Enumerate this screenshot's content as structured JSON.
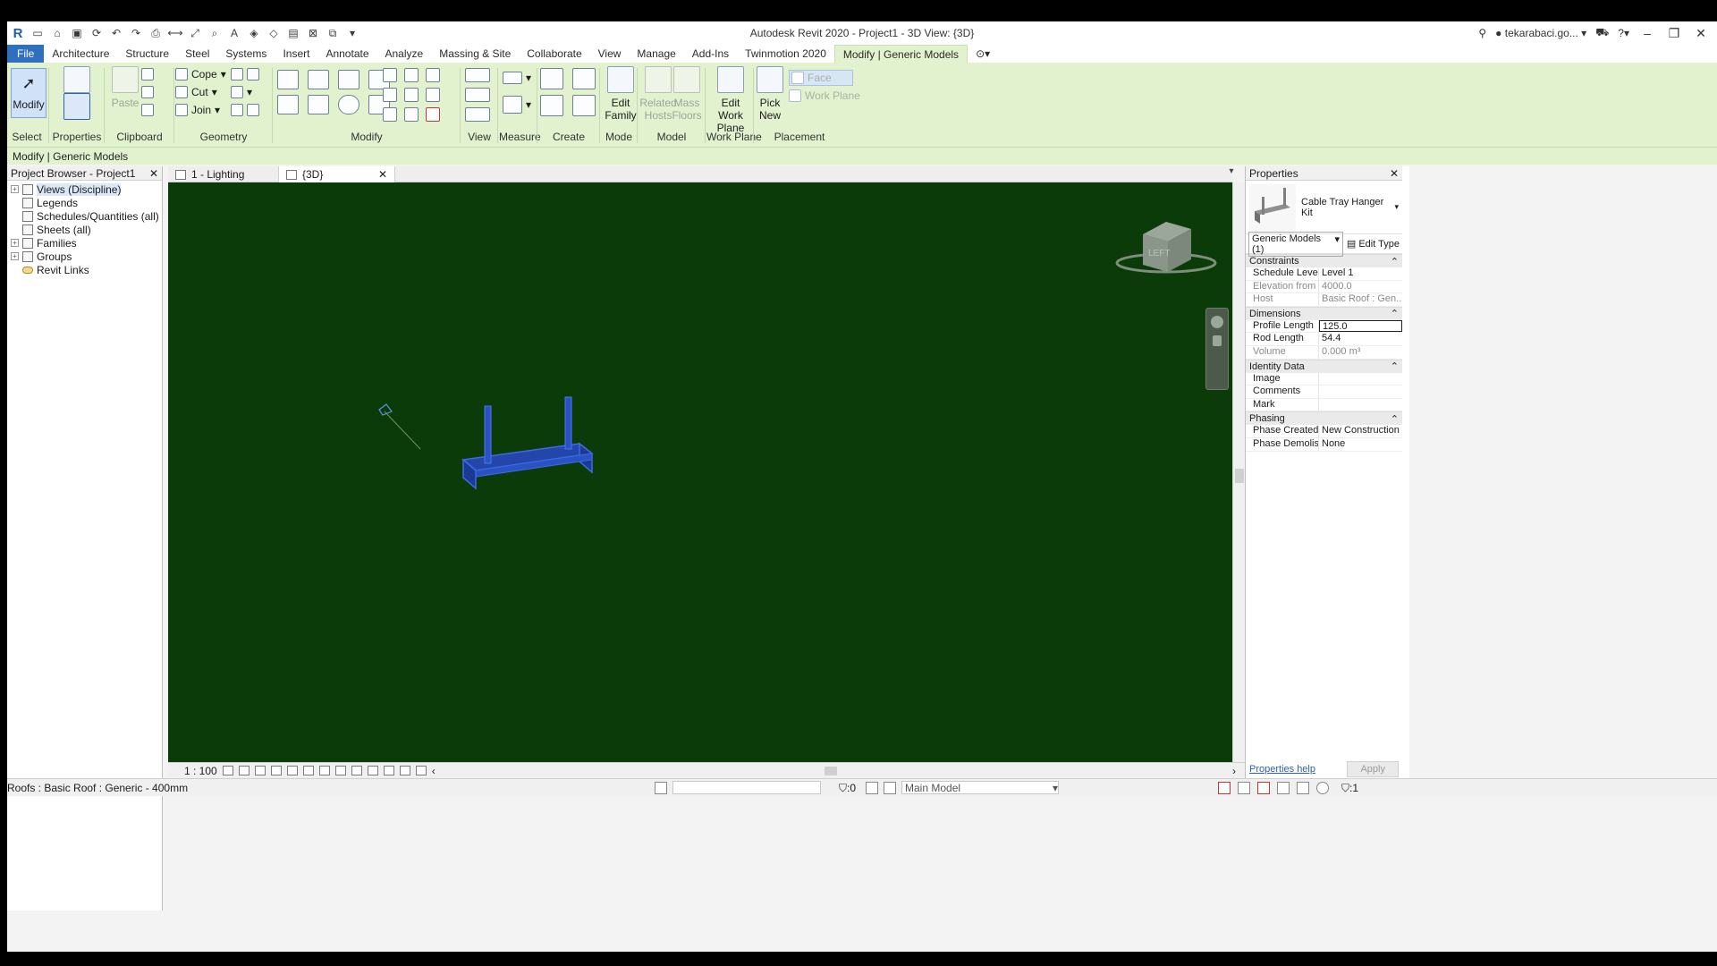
{
  "app": {
    "title": "Autodesk Revit 2020 - Project1 - 3D View: {3D}",
    "user": "tekarabaci.go...",
    "logo_letter": "R"
  },
  "tabs": [
    "File",
    "Architecture",
    "Structure",
    "Steel",
    "Systems",
    "Insert",
    "Annotate",
    "Analyze",
    "Massing & Site",
    "Collaborate",
    "View",
    "Manage",
    "Add-Ins",
    "Twinmotion 2020",
    "Modify | Generic Models"
  ],
  "ribbon": {
    "select": {
      "button": "Modify",
      "label": "Select"
    },
    "properties": {
      "label": "Properties"
    },
    "clipboard": {
      "paste": "Paste",
      "label": "Clipboard"
    },
    "geometry": {
      "cope": "Cope",
      "cut": "Cut",
      "join": "Join",
      "label": "Geometry"
    },
    "modify": {
      "label": "Modify"
    },
    "view": {
      "label": "View"
    },
    "measure": {
      "label": "Measure"
    },
    "create": {
      "label": "Create"
    },
    "mode": {
      "button": "Edit Family",
      "label": "Mode"
    },
    "model": {
      "related_hosts": "Related Hosts",
      "mass_floors": "Mass Floors",
      "label": "Model"
    },
    "work_plane": {
      "button": "Edit Work Plane",
      "label": "Work Plane"
    },
    "placement": {
      "pick_new": "Pick New",
      "face": "Face",
      "work_plane": "Work Plane",
      "label": "Placement"
    }
  },
  "options_bar": {
    "text": "Modify | Generic Models"
  },
  "project_browser": {
    "title": "Project Browser - Project1",
    "items": [
      {
        "label": "Views (Discipline)",
        "expander": "+",
        "selected": true
      },
      {
        "label": "Legends",
        "expander": ""
      },
      {
        "label": "Schedules/Quantities (all)",
        "expander": ""
      },
      {
        "label": "Sheets (all)",
        "expander": ""
      },
      {
        "label": "Families",
        "expander": "+"
      },
      {
        "label": "Groups",
        "expander": "+"
      },
      {
        "label": "Revit Links",
        "expander": ""
      }
    ]
  },
  "view_tabs": [
    {
      "label": "1 - Lighting"
    },
    {
      "label": "{3D}"
    }
  ],
  "view_control": {
    "scale": "1 : 100"
  },
  "view_cube": {
    "face": "LEFT"
  },
  "properties": {
    "title": "Properties",
    "type_name": "Cable Tray Hanger Kit",
    "instance_filter": "Generic Models (1)",
    "edit_type": "Edit Type",
    "groups": [
      {
        "name": "Constraints",
        "rows": [
          {
            "name": "Schedule Level",
            "value": "Level 1",
            "readonly": false
          },
          {
            "name": "Elevation from ...",
            "value": "4000.0",
            "readonly": true
          },
          {
            "name": "Host",
            "value": "Basic Roof : Gen...",
            "readonly": true
          }
        ]
      },
      {
        "name": "Dimensions",
        "rows": [
          {
            "name": "Profile Length",
            "value": "125.0",
            "readonly": false,
            "editing": true
          },
          {
            "name": "Rod Length",
            "value": "54.4",
            "readonly": false
          },
          {
            "name": "Volume",
            "value": "0.000 m³",
            "readonly": true
          }
        ]
      },
      {
        "name": "Identity Data",
        "rows": [
          {
            "name": "Image",
            "value": "",
            "readonly": false
          },
          {
            "name": "Comments",
            "value": "",
            "readonly": false
          },
          {
            "name": "Mark",
            "value": "",
            "readonly": false
          }
        ]
      },
      {
        "name": "Phasing",
        "rows": [
          {
            "name": "Phase Created",
            "value": "New Construction",
            "readonly": false
          },
          {
            "name": "Phase Demolish...",
            "value": "None",
            "readonly": false
          }
        ]
      }
    ],
    "help_link": "Properties help",
    "apply": "Apply"
  },
  "status_bar": {
    "text": "Roofs : Basic Roof : Generic - 400mm",
    "selection_count": ":0",
    "active_model": "Main Model",
    "filter_count": ":1"
  },
  "colors": {
    "ribbon_bg": "#e2f2cf",
    "viewport_bg": "#0b3b08",
    "file_tab": "#2f6fc0",
    "model_blue": "#2e62d8"
  }
}
